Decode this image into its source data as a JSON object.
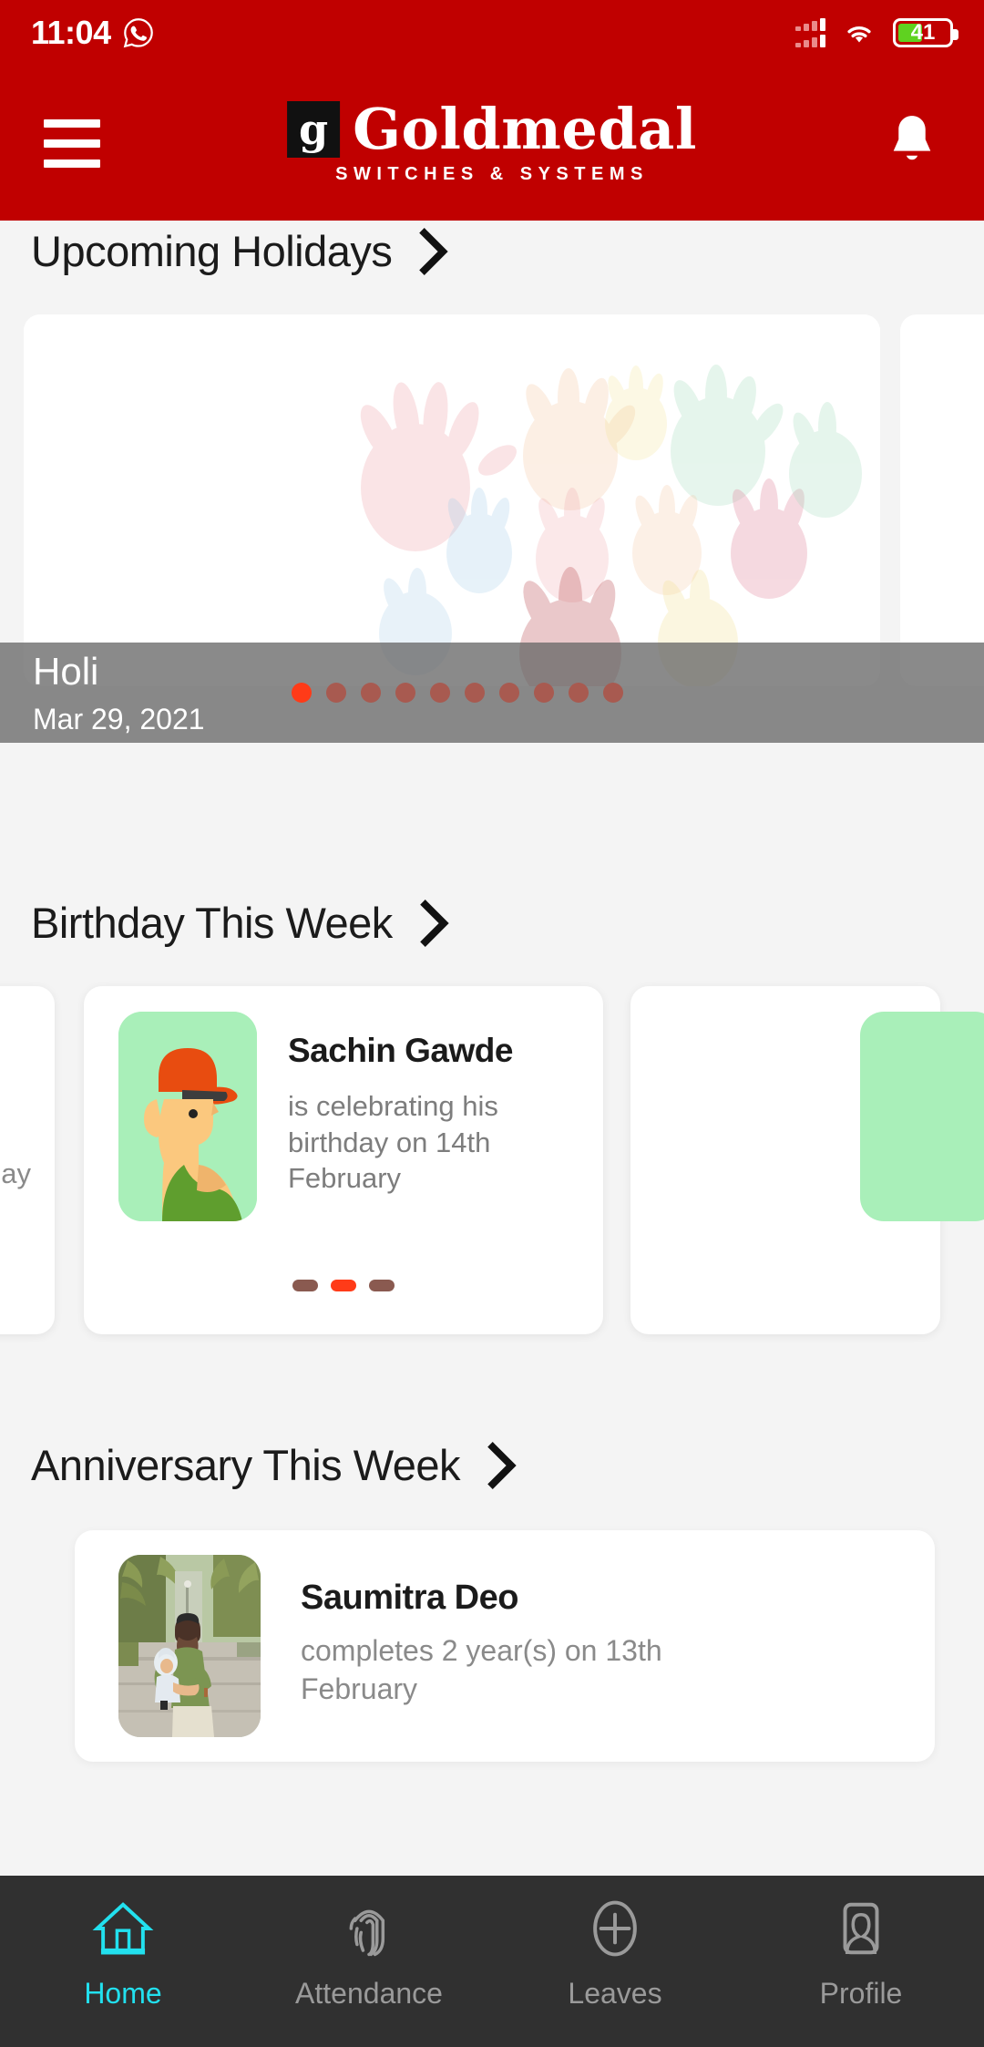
{
  "statusbar": {
    "time": "11:04",
    "whatsapp_icon": "whatsapp-icon",
    "signal_icon": "cellular-signal-icon",
    "wifi_icon": "wifi-icon",
    "battery_level": "41",
    "battery_icon": "battery-icon"
  },
  "appbar": {
    "menu_icon": "hamburger-menu-icon",
    "logo_mark": "g",
    "brand_name": "Goldmedal",
    "brand_tagline": "SWITCHES & SYSTEMS",
    "notification_icon": "bell-icon"
  },
  "holidays": {
    "section_title": "Upcoming Holidays",
    "chevron_icon": "chevron-right-icon",
    "current": {
      "name": "Holi",
      "date": "Mar 29, 2021",
      "image_alt": "colorful-handprints-holi-image"
    },
    "dots_total": 10,
    "dots_active_index": 0
  },
  "birthdays": {
    "section_title": "Birthday This Week",
    "chevron_icon": "chevron-right-icon",
    "current": {
      "name": "Sachin  Gawde",
      "message": "is celebrating his birthday on 14th February",
      "avatar_alt": "man-with-orange-cap-illustration"
    },
    "prev_peek_text": "day",
    "dots_total": 3,
    "dots_active_index": 1
  },
  "anniversaries": {
    "section_title": "Anniversary This Week",
    "chevron_icon": "chevron-right-icon",
    "current": {
      "name": "Saumitra  Deo",
      "message": "completes 2 year(s) on 13th February",
      "photo_alt": "man-holding-child-outdoor-photo"
    }
  },
  "bottom_nav": {
    "items": [
      {
        "label": "Home",
        "icon": "home-icon",
        "active": true
      },
      {
        "label": "Attendance",
        "icon": "fingerprint-icon",
        "active": false
      },
      {
        "label": "Leaves",
        "icon": "plus-circle-icon",
        "active": false
      },
      {
        "label": "Profile",
        "icon": "person-card-icon",
        "active": false
      }
    ]
  },
  "colors": {
    "brand_red": "#c00000",
    "accent_cyan": "#22e0ee",
    "dot_active": "#ff3b18",
    "page_bg": "#f4f4f4",
    "nav_bg": "#303030"
  }
}
